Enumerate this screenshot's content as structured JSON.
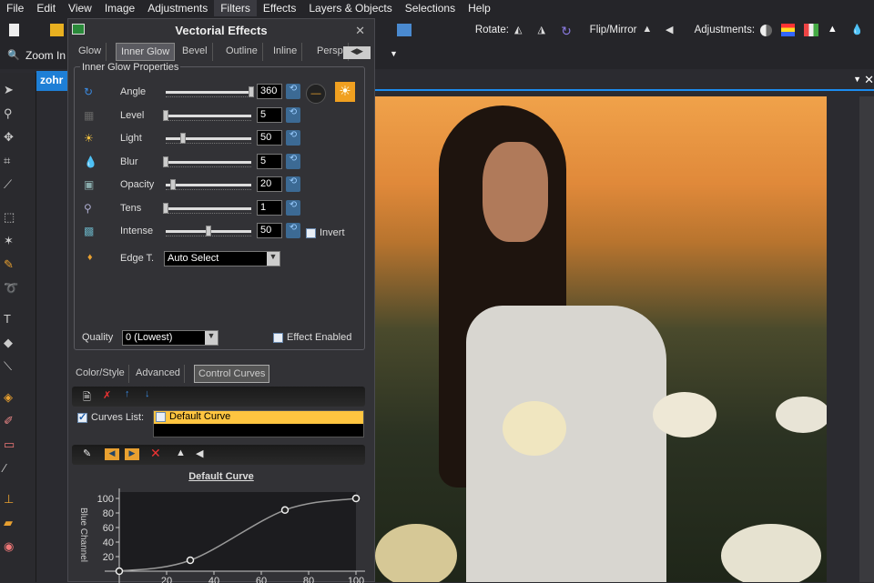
{
  "menu": [
    "File",
    "Edit",
    "View",
    "Image",
    "Adjustments",
    "Filters",
    "Effects",
    "Layers & Objects",
    "Selections",
    "Help"
  ],
  "toolbar": {
    "rotate_label": "Rotate:",
    "flip_label": "Flip/Mirror",
    "adjust_label": "Adjustments:",
    "zoom_in": "Zoom In"
  },
  "document": {
    "tab_label": "zohr"
  },
  "dialog": {
    "title": "Vectorial Effects",
    "tabs": [
      "Glow",
      "Inner Glow",
      "Bevel",
      "Outline",
      "Inline",
      "Persp"
    ],
    "active_tab": "Inner Glow",
    "group_title": "Inner Glow Properties",
    "params": [
      {
        "label": "Angle",
        "value": "360",
        "fraction": 1.0
      },
      {
        "label": "Level",
        "value": "5",
        "fraction": 0.0
      },
      {
        "label": "Light",
        "value": "50",
        "fraction": 0.2
      },
      {
        "label": "Blur",
        "value": "5",
        "fraction": 0.0
      },
      {
        "label": "Opacity",
        "value": "20",
        "fraction": 0.08
      },
      {
        "label": "Tens",
        "value": "1",
        "fraction": 0.0
      },
      {
        "label": "Intense",
        "value": "50",
        "fraction": 0.5
      }
    ],
    "invert_label": "Invert",
    "edge_label": "Edge T.",
    "edge_value": "Auto Select",
    "quality_label": "Quality",
    "quality_value": "0 (Lowest)",
    "effect_enabled_label": "Effect Enabled",
    "bottom_tabs": [
      "Color/Style",
      "Advanced",
      "Control Curves"
    ],
    "curves_list_label": "Curves List:",
    "curves": [
      "Default Curve"
    ],
    "curve_title": "Default Curve"
  },
  "chart_data": {
    "type": "line",
    "title": "Default Curve",
    "ylabel": "Blue Channel",
    "xlim": [
      0,
      100
    ],
    "ylim": [
      0,
      100
    ],
    "xticks": [
      20,
      40,
      60,
      80,
      100
    ],
    "yticks": [
      20,
      40,
      60,
      80,
      100
    ],
    "points": [
      [
        0,
        0
      ],
      [
        30,
        15
      ],
      [
        70,
        84
      ],
      [
        100,
        100
      ]
    ]
  }
}
